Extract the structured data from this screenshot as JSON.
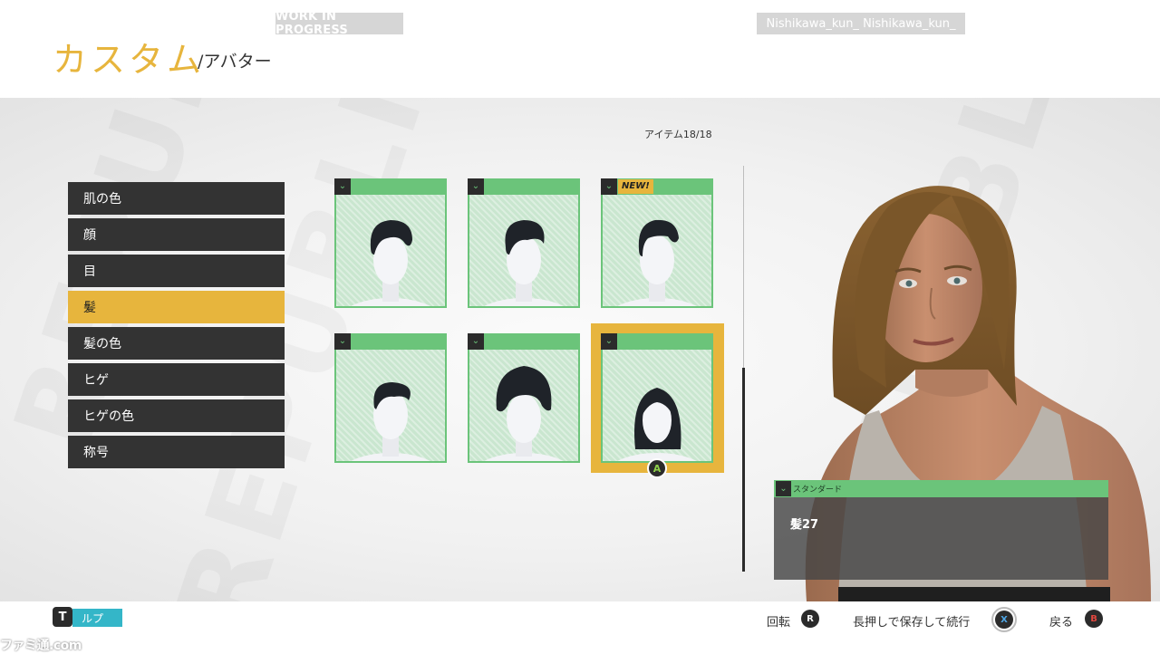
{
  "header": {
    "wip_badge": "WORK IN PROGRESS",
    "user_badge": "Nishikawa_kun_ Nishikawa_kun_",
    "title": "カスタム",
    "subtitle": "/アバター"
  },
  "categories": [
    {
      "label": "肌の色",
      "active": false
    },
    {
      "label": "顔",
      "active": false
    },
    {
      "label": "目",
      "active": false
    },
    {
      "label": "髪",
      "active": true
    },
    {
      "label": "髪の色",
      "active": false
    },
    {
      "label": "ヒゲ",
      "active": false
    },
    {
      "label": "ヒゲの色",
      "active": false
    },
    {
      "label": "称号",
      "active": false
    }
  ],
  "item_count": "アイテム18/18",
  "hair_items": [
    {
      "style": "short-wavy",
      "new": false,
      "selected": false
    },
    {
      "style": "short-curly",
      "new": false,
      "selected": false
    },
    {
      "style": "short-tuft",
      "new": true,
      "new_label": "NEW!",
      "selected": false
    },
    {
      "style": "crew",
      "new": false,
      "selected": false
    },
    {
      "style": "afro",
      "new": false,
      "selected": false
    },
    {
      "style": "long-bob",
      "new": false,
      "selected": true
    }
  ],
  "select_button": "A",
  "info_panel": {
    "tag": "スタンダード",
    "name": "髪27"
  },
  "footer": {
    "help_icon": "T",
    "help_label": "ルプ",
    "rotate_label": "回転",
    "rotate_button": "R",
    "save_label": "長押しで保存して続行",
    "save_button": "X",
    "back_label": "戻る",
    "back_button": "B",
    "watermark": "ファミ通.com"
  },
  "colors": {
    "accent_gold": "#e7b53d",
    "accent_green": "#6bc47a",
    "menu_dark": "#333333",
    "help_cyan": "#34b6c8"
  }
}
